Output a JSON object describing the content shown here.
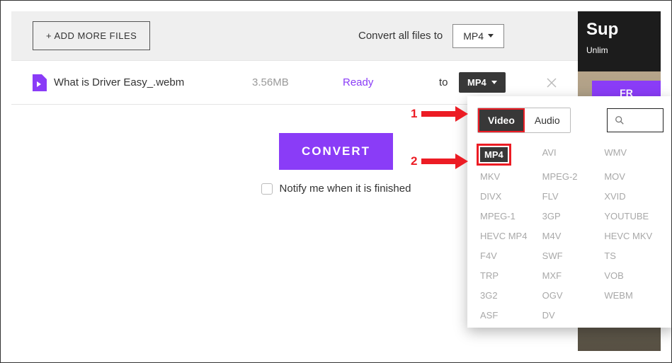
{
  "toolbar": {
    "add_more_label": "+ ADD MORE FILES",
    "convert_all_label": "Convert all files to",
    "convert_all_format": "MP4"
  },
  "file": {
    "name": "What is Driver Easy_.webm",
    "size": "3.56MB",
    "status": "Ready",
    "to_label": "to",
    "format": "MP4"
  },
  "actions": {
    "convert_label": "CONVERT",
    "notify_label": "Notify me when it is finished"
  },
  "promo": {
    "title": "Sup",
    "subtitle": "Unlim",
    "button": "FR"
  },
  "dropdown": {
    "tab_video": "Video",
    "tab_audio": "Audio",
    "search_placeholder": "",
    "formats_col1": [
      "MP4",
      "MKV",
      "DIVX",
      "MPEG-1",
      "HEVC MP4",
      "F4V",
      "TRP",
      "3G2",
      "ASF"
    ],
    "formats_col2": [
      "AVI",
      "MPEG-2",
      "FLV",
      "3GP",
      "M4V",
      "SWF",
      "MXF",
      "OGV",
      "DV"
    ],
    "formats_col3": [
      "WMV",
      "MOV",
      "XVID",
      "YOUTUBE",
      "HEVC MKV",
      "TS",
      "VOB",
      "WEBM",
      ""
    ]
  },
  "annotations": {
    "step1": "1",
    "step2": "2"
  }
}
